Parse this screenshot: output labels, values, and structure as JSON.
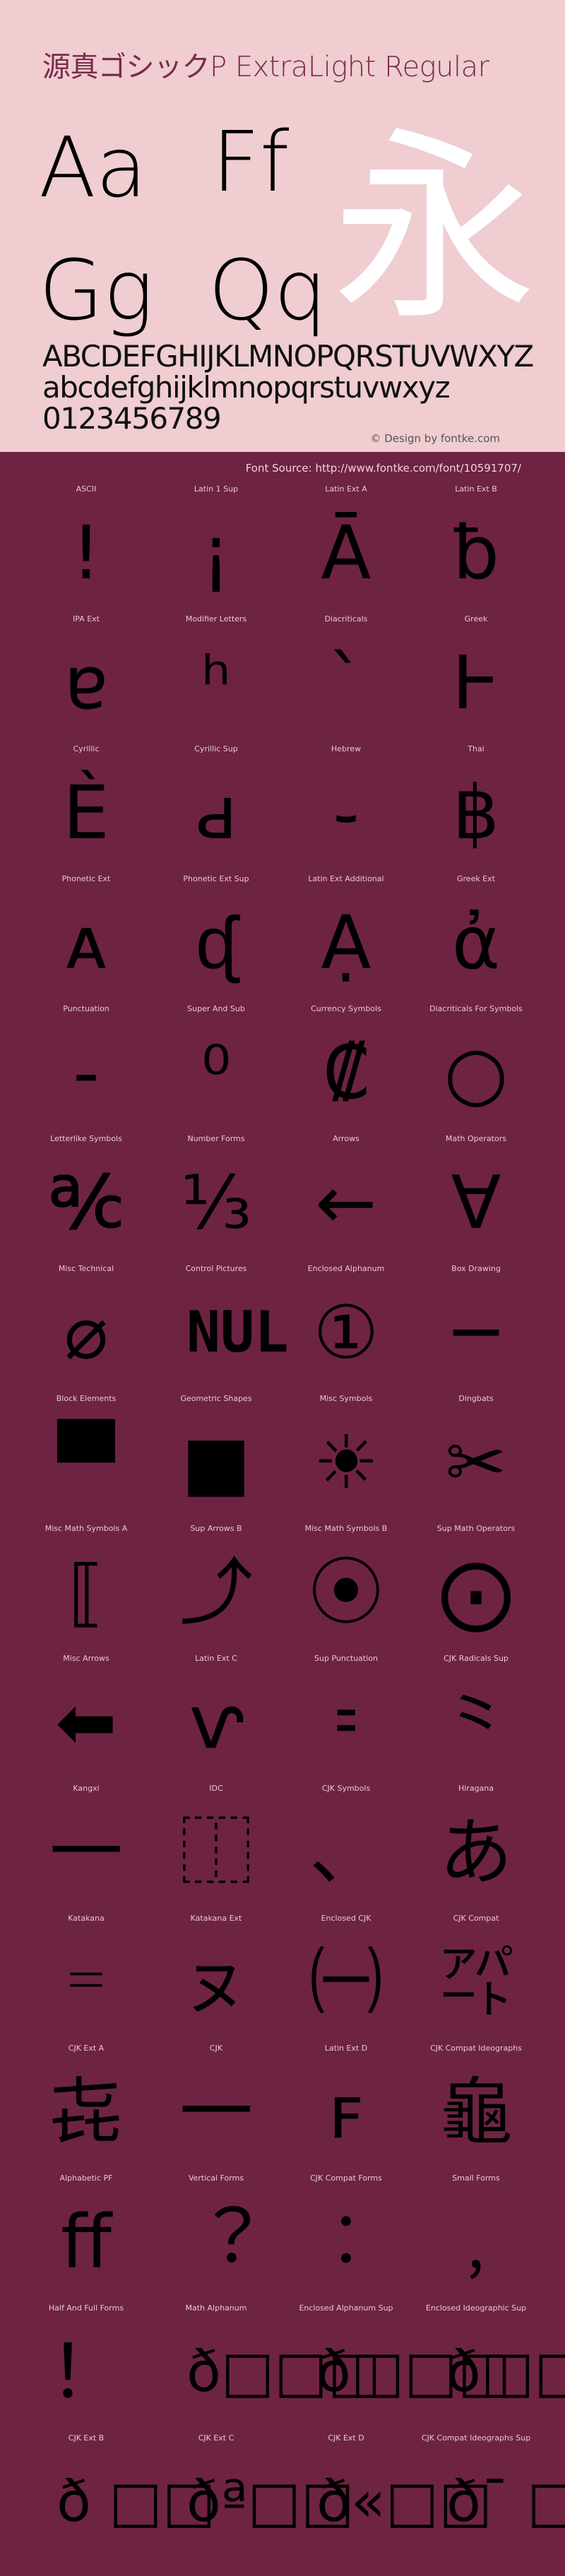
{
  "header": {
    "title": "源真ゴシックP ExtraLight Regular",
    "samples": [
      "Aa",
      "Ff",
      "Gg",
      "Qq"
    ],
    "hero_glyph": "永",
    "uppercase": "ABCDEFGHIJKLMNOPQRSTUVWXYZ",
    "lowercase": "abcdefghijklmnopqrstuvwxyz",
    "digits": "0123456789",
    "credit": "© Design by fontke.com",
    "source": "Font Source: http://www.fontke.com/font/10591707/"
  },
  "colors": {
    "header_bg": "#efcdd1",
    "body_bg": "#6e2342",
    "title": "#7a2a4a",
    "hero": "#ffffff"
  },
  "blocks": [
    {
      "label": "ASCII",
      "glyph": "!"
    },
    {
      "label": "Latin 1 Sup",
      "glyph": "¡"
    },
    {
      "label": "Latin Ext A",
      "glyph": "Ā"
    },
    {
      "label": "Latin Ext B",
      "glyph": "ƀ"
    },
    {
      "label": "IPA Ext",
      "glyph": "ɐ"
    },
    {
      "label": "Modifier Letters",
      "glyph": "ʰ"
    },
    {
      "label": "Diacriticals",
      "glyph": "`"
    },
    {
      "label": "Greek",
      "glyph": "Ͱ"
    },
    {
      "label": "Cyrillic",
      "glyph": "Ѐ"
    },
    {
      "label": "Cyrillic Sup",
      "glyph": "ԁ"
    },
    {
      "label": "Hebrew",
      "glyph": "֊"
    },
    {
      "label": "Thai",
      "glyph": "฿"
    },
    {
      "label": "Phonetic Ext",
      "glyph": "ᴀ"
    },
    {
      "label": "Phonetic Ext Sup",
      "glyph": "ᶑ"
    },
    {
      "label": "Latin Ext Additional",
      "glyph": "Ạ"
    },
    {
      "label": "Greek Ext",
      "glyph": "ἀ"
    },
    {
      "label": "Punctuation",
      "glyph": "‐"
    },
    {
      "label": "Super And Sub",
      "glyph": "⁰"
    },
    {
      "label": "Currency Symbols",
      "glyph": "₡"
    },
    {
      "label": "Diacriticals For Symbols",
      "glyph": "○"
    },
    {
      "label": "Letterlike Symbols",
      "glyph": "℀"
    },
    {
      "label": "Number Forms",
      "glyph": "⅓"
    },
    {
      "label": "Arrows",
      "glyph": "←"
    },
    {
      "label": "Math Operators",
      "glyph": "∀"
    },
    {
      "label": "Misc Technical",
      "glyph": "⌀"
    },
    {
      "label": "Control Pictures",
      "glyph": "NUL"
    },
    {
      "label": "Enclosed Alphanum",
      "glyph": "①"
    },
    {
      "label": "Box Drawing",
      "glyph": "─"
    },
    {
      "label": "Block Elements",
      "glyph": "▀"
    },
    {
      "label": "Geometric Shapes",
      "glyph": "■"
    },
    {
      "label": "Misc Symbols",
      "glyph": "☀"
    },
    {
      "label": "Dingbats",
      "glyph": "✂"
    },
    {
      "label": "Misc Math Symbols A",
      "glyph": "⟦"
    },
    {
      "label": "Sup Arrows B",
      "glyph": "⤴"
    },
    {
      "label": "Misc Math Symbols B",
      "glyph": "⦿"
    },
    {
      "label": "Sup Math Operators",
      "glyph": "⨀"
    },
    {
      "label": "Misc Arrows",
      "glyph": "⬅"
    },
    {
      "label": "Latin Ext C",
      "glyph": "ⱱ"
    },
    {
      "label": "Sup Punctuation",
      "glyph": "⹀"
    },
    {
      "label": "CJK Radicals Sup",
      "glyph": "⺀"
    },
    {
      "label": "Kangxi",
      "glyph": "⼀"
    },
    {
      "label": "IDC",
      "glyph": "⿰"
    },
    {
      "label": "CJK Symbols",
      "glyph": "、"
    },
    {
      "label": "Hiragana",
      "glyph": "あ"
    },
    {
      "label": "Katakana",
      "glyph": "゠"
    },
    {
      "label": "Katakana Ext",
      "glyph": "ㇴ"
    },
    {
      "label": "Enclosed CJK",
      "glyph": "㈠"
    },
    {
      "label": "CJK Compat",
      "glyph": "㌀"
    },
    {
      "label": "CJK Ext A",
      "glyph": "㐂"
    },
    {
      "label": "CJK",
      "glyph": "一"
    },
    {
      "label": "Latin Ext D",
      "glyph": "ꜰ"
    },
    {
      "label": "CJK Compat Ideographs",
      "glyph": "龜"
    },
    {
      "label": "Alphabetic PF",
      "glyph": "ﬀ"
    },
    {
      "label": "Vertical Forms",
      "glyph": "︖"
    },
    {
      "label": "CJK Compat Forms",
      "glyph": "︰"
    },
    {
      "label": "Small Forms",
      "glyph": "﹐"
    },
    {
      "label": "Half And Full Forms",
      "glyph": "！"
    },
    {
      "label": "Math Alphanum",
      "glyph": "ð□□□"
    },
    {
      "label": "Enclosed Alphanum Sup",
      "glyph": "ð□□□"
    },
    {
      "label": "Enclosed Ideographic Sup",
      "glyph": "ð□□□"
    },
    {
      "label": "CJK Ext B",
      "glyph": "ð □□"
    },
    {
      "label": "CJK Ext C",
      "glyph": "ðª□□"
    },
    {
      "label": "CJK Ext D",
      "glyph": "ð«□□"
    },
    {
      "label": "CJK Compat Ideographs Sup",
      "glyph": "ð¯ □"
    }
  ]
}
